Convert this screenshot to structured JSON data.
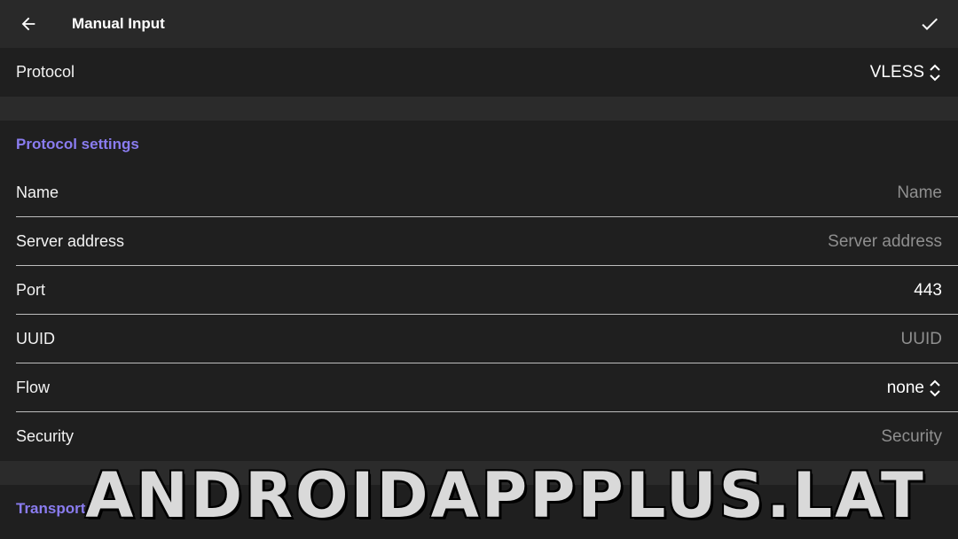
{
  "appbar": {
    "title": "Manual Input",
    "back_icon": "arrow-back-icon",
    "confirm_icon": "check-icon"
  },
  "protocol": {
    "label": "Protocol",
    "value": "VLESS"
  },
  "protocol_settings": {
    "header": "Protocol settings",
    "fields": [
      {
        "label": "Name",
        "value": "Name",
        "is_hint": true
      },
      {
        "label": "Server address",
        "value": "Server address",
        "is_hint": true
      },
      {
        "label": "Port",
        "value": "443",
        "is_hint": false
      },
      {
        "label": "UUID",
        "value": "UUID",
        "is_hint": true
      },
      {
        "label": "Flow",
        "value": "none",
        "is_hint": false,
        "dropdown": true
      },
      {
        "label": "Security",
        "value": "Security",
        "is_hint": true
      }
    ]
  },
  "transport": {
    "header": "Transport"
  },
  "watermark": "ANDROIDAPPPLUS.LAT",
  "colors": {
    "accent": "#8a7cf0",
    "appbar_bg": "#292929",
    "bg": "#1f1f1f",
    "hint": "#8f8f8f"
  }
}
